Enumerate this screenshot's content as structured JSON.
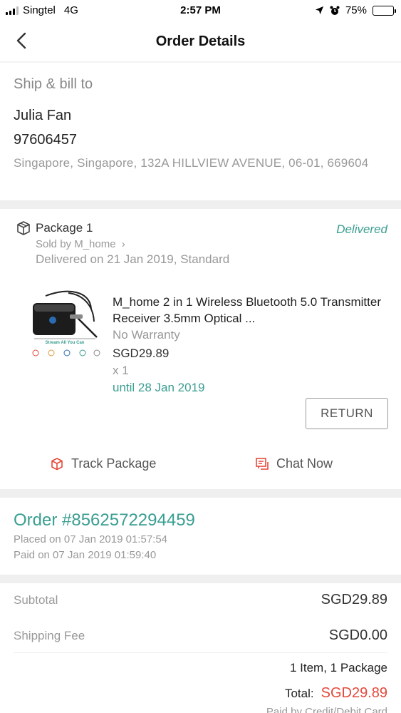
{
  "status_bar": {
    "carrier": "Singtel",
    "network": "4G",
    "time": "2:57 PM",
    "battery_percent": "75%",
    "battery_level": 0.75,
    "icons": [
      "signal-icon",
      "location-arrow-icon",
      "alarm-icon",
      "battery-icon"
    ]
  },
  "nav": {
    "title": "Order Details",
    "back_icon": "chevron-left-icon"
  },
  "shipping": {
    "heading": "Ship & bill to",
    "name": "Julia Fan",
    "phone": "97606457",
    "address": "Singapore, Singapore, 132A HILLVIEW AVENUE, 06-01, 669604"
  },
  "package": {
    "title": "Package 1",
    "status": "Delivered",
    "seller": "Sold by M_home",
    "delivered_on": "Delivered on 21 Jan 2019, Standard",
    "product": {
      "name": "M_home 2 in 1 Wireless Bluetooth 5.0 Transmitter Receiver 3.5mm Optical ...",
      "warranty": "No Warranty",
      "price": "SGD29.89",
      "quantity": "x 1",
      "until": "until  28 Jan 2019",
      "image_caption": "Stream All You Can"
    },
    "return_label": "RETURN",
    "track_label": "Track Package",
    "chat_label": "Chat Now"
  },
  "order": {
    "number": "Order #8562572294459",
    "placed": "Placed on 07 Jan 2019  01:57:54",
    "paid": "Paid on 07 Jan 2019  01:59:40"
  },
  "summary": {
    "subtotal_label": "Subtotal",
    "subtotal_value": "SGD29.89",
    "shipping_label": "Shipping Fee",
    "shipping_value": "SGD0.00",
    "items_count": "1 Item, 1 Package",
    "total_label": "Total:",
    "total_value": "SGD29.89",
    "paid_by": "Paid by Credit/Debit Card"
  },
  "colors": {
    "accent_green": "#3a9e91",
    "accent_orange": "#e4493a",
    "muted_text": "#999999"
  }
}
